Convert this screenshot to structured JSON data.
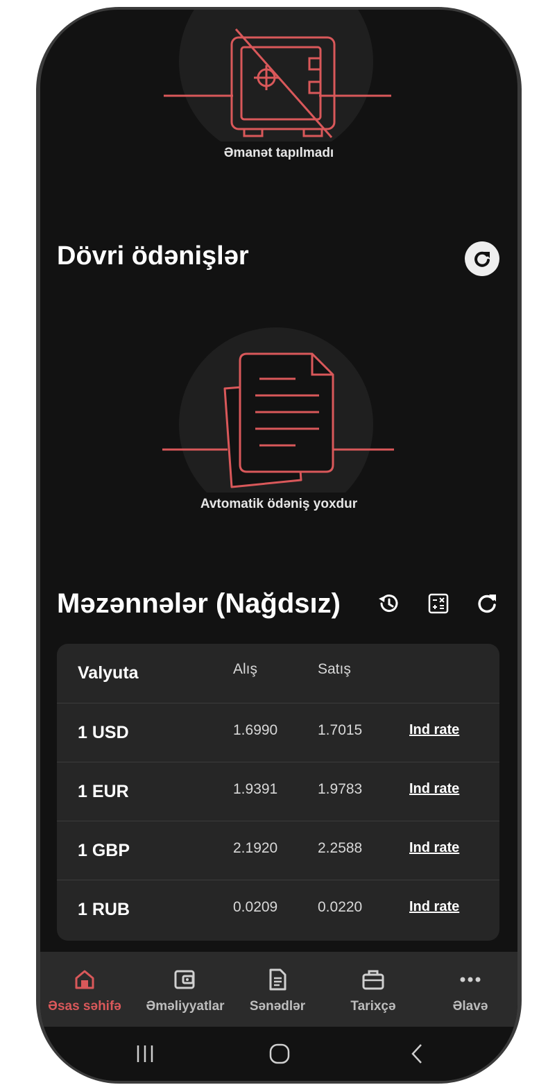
{
  "colors": {
    "accent": "#d9585a",
    "background": "#121212",
    "card": "#262626",
    "nav": "#2b2b2b"
  },
  "deposit": {
    "empty_label": "Əmanət tapılmadı",
    "illustration_icon": "crossed-safe-icon"
  },
  "recurring": {
    "title": "Dövri ödənişlər",
    "empty_label": "Avtomatik ödəniş yoxdur",
    "refresh_icon": "refresh-icon",
    "illustration_icon": "documents-icon"
  },
  "rates": {
    "title": "Məzənnələr (Nağdsız)",
    "tool_icons": [
      "history-icon",
      "calculator-icon",
      "refresh-icon"
    ],
    "headers": {
      "currency": "Valyuta",
      "buy": "Alış",
      "sell": "Satış"
    },
    "rows": [
      {
        "currency": "1 USD",
        "buy": "1.6990",
        "sell": "1.7015",
        "link": "Ind rate"
      },
      {
        "currency": "1 EUR",
        "buy": "1.9391",
        "sell": "1.9783",
        "link": "Ind rate"
      },
      {
        "currency": "1 GBP",
        "buy": "2.1920",
        "sell": "2.2588",
        "link": "Ind rate"
      },
      {
        "currency": "1 RUB",
        "buy": "0.0209",
        "sell": "0.0220",
        "link": "Ind rate"
      }
    ]
  },
  "nav": {
    "items": [
      {
        "label": "Əsas səhifə",
        "icon": "home-icon",
        "active": true
      },
      {
        "label": "Əməliyyatlar",
        "icon": "wallet-icon",
        "active": false
      },
      {
        "label": "Sənədlər",
        "icon": "document-icon",
        "active": false
      },
      {
        "label": "Tarixçə",
        "icon": "briefcase-icon",
        "active": false
      },
      {
        "label": "Əlavə",
        "icon": "more-icon",
        "active": false
      }
    ]
  },
  "system_nav": [
    "recent-apps-icon",
    "home-button-icon",
    "back-icon"
  ]
}
